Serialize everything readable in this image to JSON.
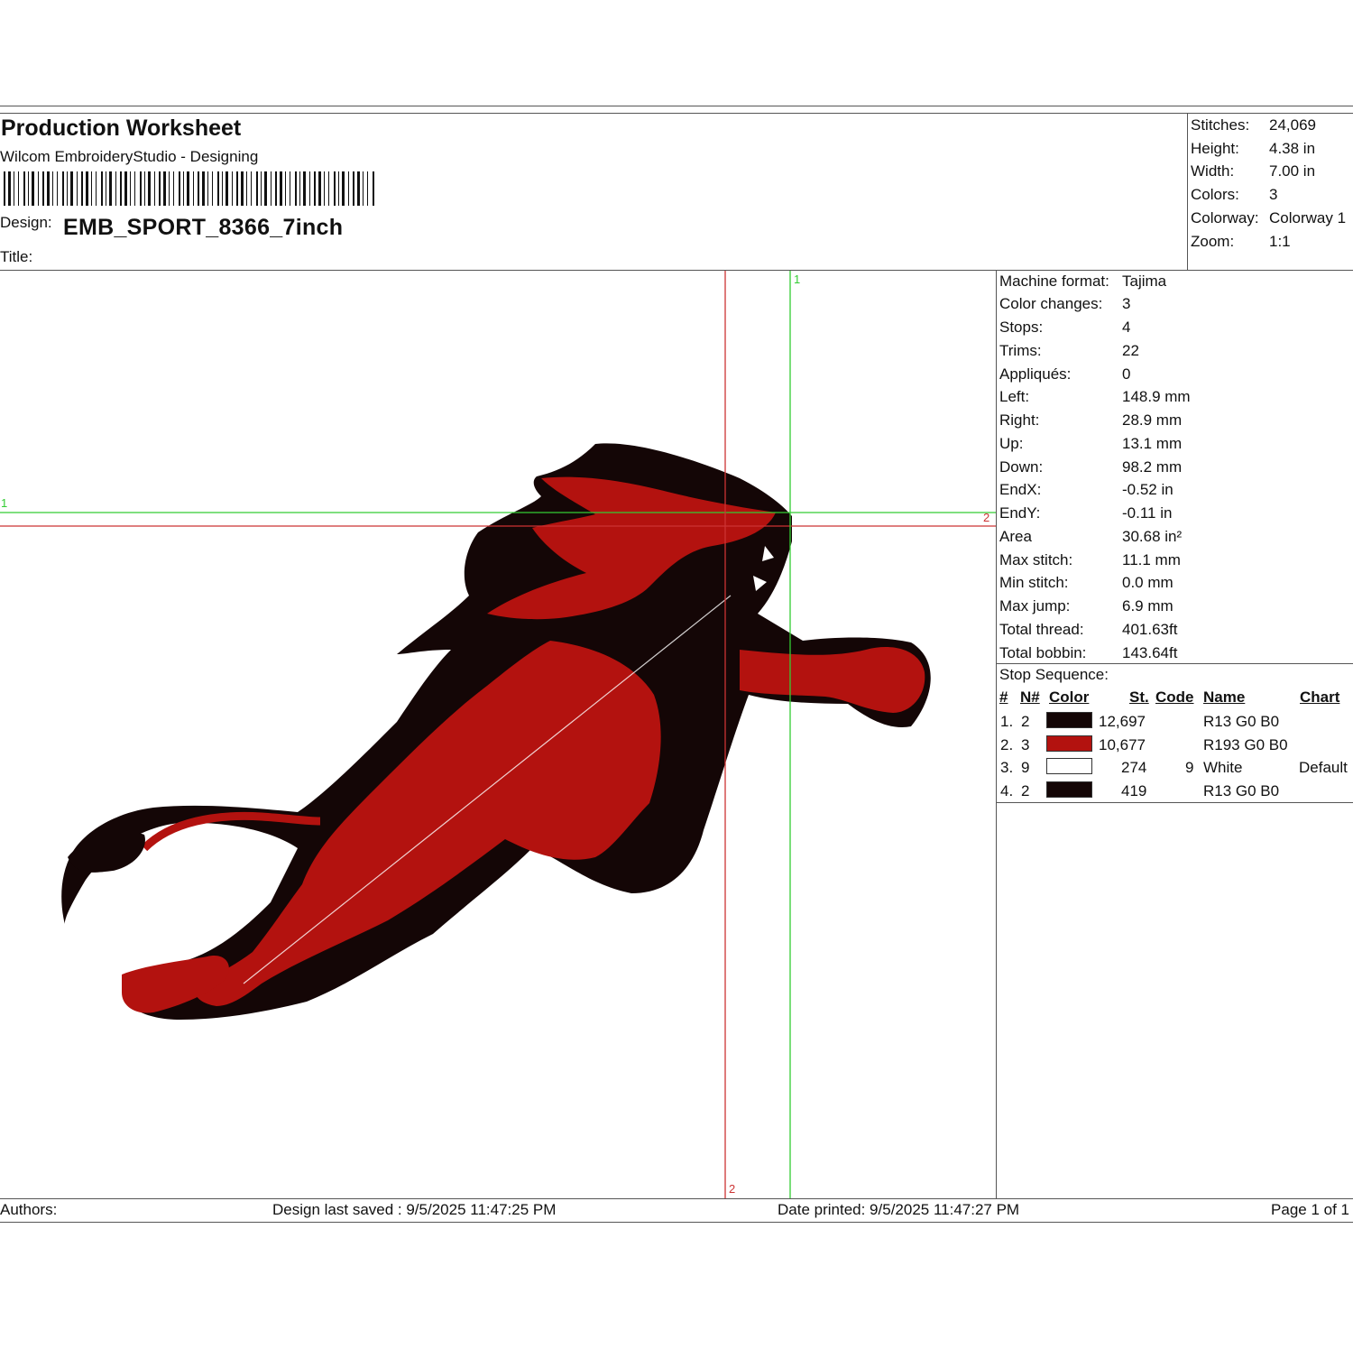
{
  "header": {
    "title": "Production Worksheet",
    "subtitle": "Wilcom EmbroideryStudio - Designing",
    "design_label": "Design:",
    "design_name": "EMB_SPORT_8366_7inch",
    "title_label": "Title:"
  },
  "summary": [
    {
      "label": "Stitches:",
      "value": "24,069"
    },
    {
      "label": "Height:",
      "value": "4.38 in"
    },
    {
      "label": "Width:",
      "value": "7.00 in"
    },
    {
      "label": "Colors:",
      "value": "3"
    },
    {
      "label": "Colorway:",
      "value": "Colorway 1"
    },
    {
      "label": "Zoom:",
      "value": "1:1"
    }
  ],
  "details": [
    {
      "label": "Machine format:",
      "value": "Tajima"
    },
    {
      "label": "Color changes:",
      "value": "3"
    },
    {
      "label": "Stops:",
      "value": "4"
    },
    {
      "label": "Trims:",
      "value": "22"
    },
    {
      "label": "Appliqués:",
      "value": "0"
    },
    {
      "label": "Left:",
      "value": "148.9 mm"
    },
    {
      "label": "Right:",
      "value": "28.9 mm"
    },
    {
      "label": "Up:",
      "value": "13.1 mm"
    },
    {
      "label": "Down:",
      "value": "98.2 mm"
    },
    {
      "label": "EndX:",
      "value": "-0.52 in"
    },
    {
      "label": "EndY:",
      "value": "-0.11 in"
    },
    {
      "label": "Area",
      "value": " 30.68 in²"
    },
    {
      "label": "Max stitch:",
      "value": "11.1 mm"
    },
    {
      "label": "Min stitch:",
      "value": "0.0 mm"
    },
    {
      "label": "Max jump:",
      "value": "6.9 mm"
    },
    {
      "label": "Total thread:",
      "value": "401.63ft"
    },
    {
      "label": "Total bobbin:",
      "value": "143.64ft"
    }
  ],
  "stop_sequence": {
    "title": "Stop Sequence:",
    "columns": {
      "num": "#",
      "n": "N#",
      "color": "Color",
      "st": "St.",
      "code": "Code",
      "name": "Name",
      "chart": "Chart"
    },
    "rows": [
      {
        "num": "1.",
        "n": "2",
        "color": "#140606",
        "st": "12,697",
        "code": "",
        "name": "R13 G0 B0",
        "chart": ""
      },
      {
        "num": "2.",
        "n": "3",
        "color": "#b3120f",
        "st": "10,677",
        "code": "",
        "name": "R193 G0 B0",
        "chart": ""
      },
      {
        "num": "3.",
        "n": "9",
        "color": "#ffffff",
        "st": "274",
        "code": "9",
        "name": "White",
        "chart": "Default"
      },
      {
        "num": "4.",
        "n": "2",
        "color": "#140606",
        "st": "419",
        "code": "",
        "name": "R13 G0 B0",
        "chart": ""
      }
    ]
  },
  "axes": {
    "green_v_label": "1",
    "green_h_label": "1",
    "red_h_label": "2",
    "red_v_label": "2"
  },
  "footer": {
    "authors": "Authors:",
    "last_saved": "Design last saved : 9/5/2025 11:47:25 PM",
    "printed": "Date printed: 9/5/2025 11:47:27 PM",
    "page": "Page 1 of 1"
  },
  "colors": {
    "thread_dark": "#140606",
    "thread_red": "#b3120f",
    "axis_green": "#33cc33",
    "axis_red": "#cc3333"
  }
}
